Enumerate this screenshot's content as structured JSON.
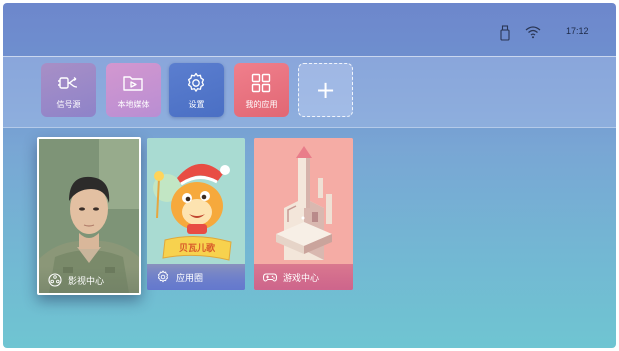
{
  "status_bar": {
    "time": "17:12",
    "icons": [
      "usb-icon",
      "wifi-icon"
    ]
  },
  "app_bar": {
    "items": [
      {
        "label": "信号源",
        "icon": "input-source-icon",
        "color": "#9b88c8"
      },
      {
        "label": "本地媒体",
        "icon": "folder-play-icon",
        "color": "#c692d1"
      },
      {
        "label": "设置",
        "icon": "gear-icon",
        "color": "#5276c9"
      },
      {
        "label": "我的应用",
        "icon": "grid-icon",
        "color": "#e8737f"
      }
    ],
    "add_button": "+"
  },
  "content_cards": [
    {
      "label": "影视中心",
      "icon": "film-reel-icon",
      "artwork": "portrait-photo"
    },
    {
      "label": "应用圈",
      "icon": "gear-icon",
      "artwork": "cartoon-bear"
    },
    {
      "label": "游戏中心",
      "icon": "gamepad-icon",
      "artwork": "castle-tower"
    }
  ]
}
